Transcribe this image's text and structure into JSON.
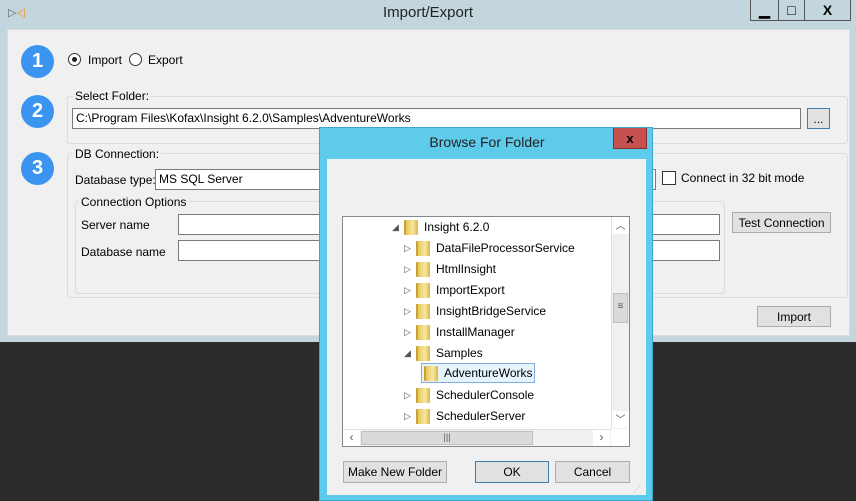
{
  "window": {
    "title": "Import/Export",
    "minimize": "▁",
    "maximize": "□",
    "close": "X"
  },
  "steps": [
    "1",
    "2",
    "3"
  ],
  "mode": {
    "import_label": "Import",
    "export_label": "Export",
    "selected": "Import"
  },
  "select_folder": {
    "label": "Select Folder:",
    "path": "C:\\Program Files\\Kofax\\Insight 6.2.0\\Samples\\AdventureWorks",
    "browse_label": "..."
  },
  "db": {
    "label": "DB Connection:",
    "type_label": "Database type:",
    "type_value": "MS SQL Server",
    "bit32_label": "Connect in 32 bit mode",
    "bit32_checked": false,
    "options_label": "Connection Options",
    "server_label": "Server name",
    "server_value": "",
    "dbname_label": "Database name",
    "dbname_value": "",
    "test_label": "Test Connection"
  },
  "import_button": "Import",
  "dialog": {
    "title": "Browse For Folder",
    "close": "x",
    "tree": [
      {
        "label": "Insight 6.2.0",
        "expanded": true,
        "level": 0
      },
      {
        "label": "DataFileProcessorService",
        "level": 1
      },
      {
        "label": "HtmlInsight",
        "level": 1
      },
      {
        "label": "ImportExport",
        "level": 1
      },
      {
        "label": "InsightBridgeService",
        "level": 1
      },
      {
        "label": "InstallManager",
        "level": 1
      },
      {
        "label": "Samples",
        "expanded": true,
        "level": 1
      },
      {
        "label": "AdventureWorks",
        "level": 2,
        "selected": true
      },
      {
        "label": "SchedulerConsole",
        "level": 1
      },
      {
        "label": "SchedulerServer",
        "level": 1
      }
    ],
    "make_new_folder": "Make New Folder",
    "ok": "OK",
    "cancel": "Cancel"
  }
}
